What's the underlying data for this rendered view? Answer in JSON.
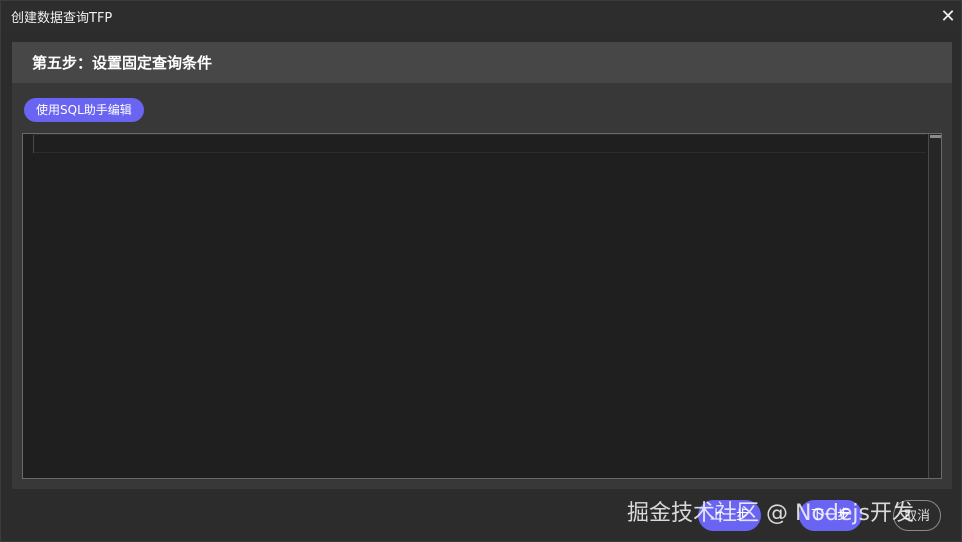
{
  "window": {
    "title": "创建数据查询TFP",
    "close_icon": "close-icon",
    "close_glyph": "✕"
  },
  "panel": {
    "step_title": "第五步：设置固定查询条件",
    "sql_helper_button": "使用SQL助手编辑",
    "editor_value": ""
  },
  "footer": {
    "prev_label": "上一步",
    "next_label": "下一步",
    "cancel_label": "取消"
  },
  "watermark": "掘金技术社区 @ Nodejs开发",
  "colors": {
    "accent": "#6a64f2",
    "background": "#2c2c2c",
    "editor_bg": "#1f1f1f",
    "header_bg": "#474747"
  }
}
